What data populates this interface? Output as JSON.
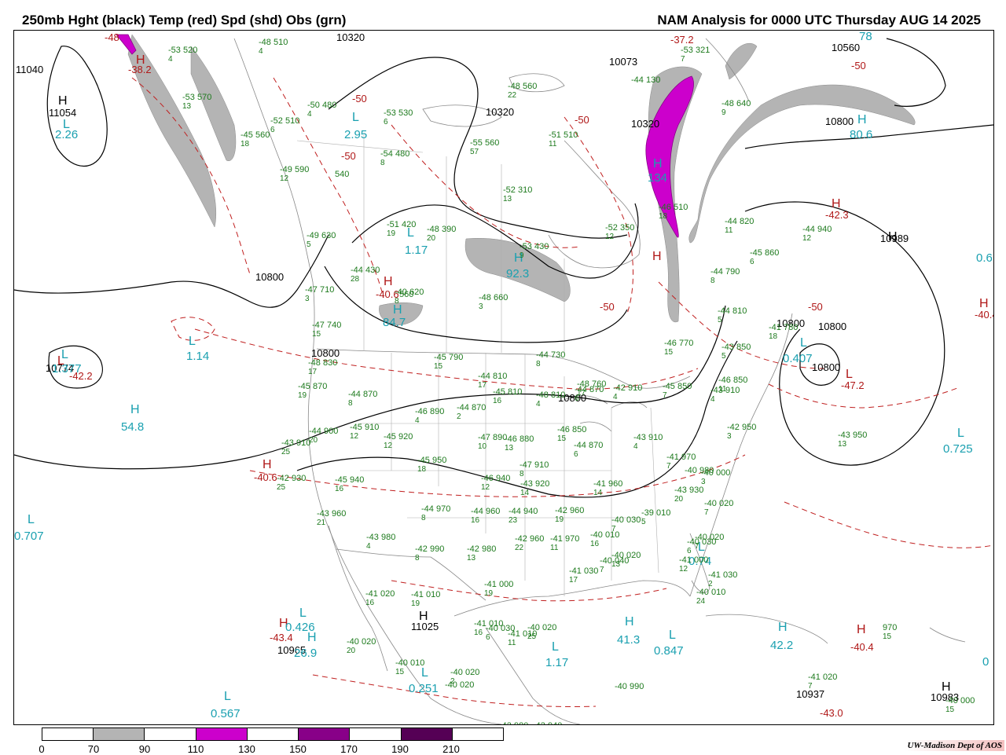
{
  "header": {
    "title_left": "250mb Hght (black) Temp (red) Spd (shd) Obs (grn)",
    "title_right": "NAM Analysis for 0000 UTC Thursday  AUG 14 2025"
  },
  "colors": {
    "height_contour": "#000000",
    "temp_contour": "#c02020",
    "speed_70_90": "#b4b4b4",
    "speed_110_130": "#cc00cc",
    "speed_150_170": "#880088",
    "speed_190_210": "#550055",
    "obs": "#1d7a1d",
    "speed_label": "#1aa0b0",
    "geography": "#888888"
  },
  "colorbar": {
    "ticks": [
      "0",
      "70",
      "90",
      "110",
      "130",
      "150",
      "170",
      "190",
      "210"
    ],
    "segments": [
      "#ffffff",
      "#b4b4b4",
      "#ffffff",
      "#cc00cc",
      "#ffffff",
      "#880088",
      "#ffffff",
      "#550055",
      "#ffffff"
    ]
  },
  "credit": "UW-Madison  Dept of AOS",
  "height_centers": [
    {
      "t": "H",
      "kind": "hgt-hl"
    },
    {
      "t": "11054",
      "kind": "hgt-val"
    },
    {
      "t": "11040",
      "kind": "hgt-val"
    },
    {
      "t": "10560",
      "kind": "hgt-val"
    },
    {
      "t": "10073",
      "kind": "hgt-val"
    },
    {
      "t": "10320",
      "kind": "hgt-val"
    },
    {
      "t": "10320",
      "kind": "hgt-val"
    },
    {
      "t": "10800",
      "kind": "hgt-val"
    },
    {
      "t": "H",
      "kind": "hgt-hl"
    },
    {
      "t": "10989",
      "kind": "hgt-val"
    },
    {
      "t": "10800",
      "kind": "hgt-val"
    },
    {
      "t": "10800",
      "kind": "hgt-val"
    },
    {
      "t": "10800",
      "kind": "hgt-val"
    },
    {
      "t": "10800",
      "kind": "hgt-val"
    },
    {
      "t": "10800",
      "kind": "hgt-val"
    },
    {
      "t": "10800",
      "kind": "hgt-val"
    },
    {
      "t": "H",
      "kind": "hgt-hl"
    },
    {
      "t": "11025",
      "kind": "hgt-val"
    },
    {
      "t": "10965",
      "kind": "hgt-val"
    },
    {
      "t": "10937",
      "kind": "hgt-val"
    },
    {
      "t": "H",
      "kind": "hgt-hl"
    },
    {
      "t": "10983",
      "kind": "hgt-val"
    },
    {
      "t": "10320",
      "kind": "hgt-val"
    },
    {
      "t": "10774",
      "kind": "hgt-val"
    }
  ],
  "temp_labels": [
    {
      "t": "-48",
      "kind": "temp"
    },
    {
      "t": "H",
      "kind": "temp-hl"
    },
    {
      "t": "-38.2",
      "kind": "temp"
    },
    {
      "t": "-50",
      "kind": "temp"
    },
    {
      "t": "-50",
      "kind": "temp"
    },
    {
      "t": "-50",
      "kind": "temp"
    },
    {
      "t": "-37.2",
      "kind": "temp"
    },
    {
      "t": "-50",
      "kind": "temp"
    },
    {
      "t": "H",
      "kind": "temp-hl"
    },
    {
      "t": "-42.3",
      "kind": "temp"
    },
    {
      "t": "H",
      "kind": "temp-hl"
    },
    {
      "t": "-50",
      "kind": "temp"
    },
    {
      "t": "H",
      "kind": "temp-hl"
    },
    {
      "t": "-40.6",
      "kind": "temp"
    },
    {
      "t": "L",
      "kind": "temp-hl"
    },
    {
      "t": "-42.2",
      "kind": "temp"
    },
    {
      "t": "L",
      "kind": "temp-hl"
    },
    {
      "t": "-47.2",
      "kind": "temp"
    },
    {
      "t": "H",
      "kind": "temp-hl"
    },
    {
      "t": "-40.6",
      "kind": "temp"
    },
    {
      "t": "H",
      "kind": "temp-hl"
    },
    {
      "t": "-43.4",
      "kind": "temp"
    },
    {
      "t": "H",
      "kind": "temp-hl"
    },
    {
      "t": "-40.4",
      "kind": "temp"
    },
    {
      "t": "-43.0",
      "kind": "temp"
    },
    {
      "t": "-50",
      "kind": "temp"
    },
    {
      "t": "H",
      "kind": "temp-hl"
    },
    {
      "t": "-40.4",
      "kind": "temp"
    }
  ],
  "speed_labels": [
    {
      "t": "L",
      "kind": "spd"
    },
    {
      "t": "2.26",
      "kind": "spd-val"
    },
    {
      "t": "L",
      "kind": "spd"
    },
    {
      "t": "2.95",
      "kind": "spd-val"
    },
    {
      "t": "L",
      "kind": "spd"
    },
    {
      "t": "1.17",
      "kind": "spd-val"
    },
    {
      "t": "H",
      "kind": "spd"
    },
    {
      "t": "92.3",
      "kind": "spd-val"
    },
    {
      "t": "H",
      "kind": "spd"
    },
    {
      "t": "84.7",
      "kind": "spd-val"
    },
    {
      "t": "H",
      "kind": "spd"
    },
    {
      "t": "80.6",
      "kind": "spd-val"
    },
    {
      "t": "H",
      "kind": "spd"
    },
    {
      "t": "134",
      "kind": "spd-val"
    },
    {
      "t": "78",
      "kind": "spd-val"
    },
    {
      "t": "L",
      "kind": "spd"
    },
    {
      "t": "1.14",
      "kind": "spd-val"
    },
    {
      "t": "L",
      "kind": "spd"
    },
    {
      "t": "1.377",
      "kind": "spd-val"
    },
    {
      "t": "H",
      "kind": "spd"
    },
    {
      "t": "54.8",
      "kind": "spd-val"
    },
    {
      "t": "L",
      "kind": "spd"
    },
    {
      "t": "0.707",
      "kind": "spd-val"
    },
    {
      "t": "L",
      "kind": "spd"
    },
    {
      "t": "0.407",
      "kind": "spd-val"
    },
    {
      "t": "L",
      "kind": "spd"
    },
    {
      "t": "0.725",
      "kind": "spd-val"
    },
    {
      "t": "L",
      "kind": "spd"
    },
    {
      "t": "0.426",
      "kind": "spd-val"
    },
    {
      "t": "H",
      "kind": "spd"
    },
    {
      "t": "26.9",
      "kind": "spd-val"
    },
    {
      "t": "L",
      "kind": "spd"
    },
    {
      "t": "0.567",
      "kind": "spd-val"
    },
    {
      "t": "L",
      "kind": "spd"
    },
    {
      "t": "0.251",
      "kind": "spd-val"
    },
    {
      "t": "L",
      "kind": "spd"
    },
    {
      "t": "1.17",
      "kind": "spd-val"
    },
    {
      "t": "H",
      "kind": "spd"
    },
    {
      "t": "41.3",
      "kind": "spd-val"
    },
    {
      "t": "L",
      "kind": "spd"
    },
    {
      "t": "0.847",
      "kind": "spd-val"
    },
    {
      "t": "H",
      "kind": "spd"
    },
    {
      "t": "42.2",
      "kind": "spd-val"
    },
    {
      "t": "L",
      "kind": "spd"
    },
    {
      "t": "0.74",
      "kind": "spd-val"
    },
    {
      "t": "0.6",
      "kind": "spd-val"
    },
    {
      "t": "0",
      "kind": "spd-val"
    }
  ],
  "obs": [
    {
      "t": "-53",
      "h": "520",
      "d": "4"
    },
    {
      "t": "-48",
      "h": "510",
      "d": "4"
    },
    {
      "t": "-53",
      "h": "570",
      "d": "13"
    },
    {
      "t": "-50",
      "h": "480",
      "d": "4"
    },
    {
      "t": "-52",
      "h": "510",
      "d": "6"
    },
    {
      "t": "-53",
      "h": "530",
      "d": "6"
    },
    {
      "t": "-45",
      "h": "560",
      "d": "18"
    },
    {
      "t": "-54",
      "h": "480",
      "d": "8"
    },
    {
      "t": "-49",
      "h": "590",
      "d": "12"
    },
    {
      "t": "540",
      "h": "",
      "d": ""
    },
    {
      "t": "-48",
      "h": "560",
      "d": "22"
    },
    {
      "t": "-55",
      "h": "560",
      "d": "57"
    },
    {
      "t": "-51",
      "h": "510",
      "d": "11"
    },
    {
      "t": "-52",
      "h": "310",
      "d": "13"
    },
    {
      "t": "-44",
      "h": "130",
      "d": ""
    },
    {
      "t": "-48",
      "h": "640",
      "d": "9"
    },
    {
      "t": "-53",
      "h": "321",
      "d": "7"
    },
    {
      "t": "-51",
      "h": "420",
      "d": "19"
    },
    {
      "t": "-48",
      "h": "390",
      "d": "20"
    },
    {
      "t": "-52",
      "h": "350",
      "d": "12"
    },
    {
      "t": "-49",
      "h": "630",
      "d": "5"
    },
    {
      "t": "-44",
      "h": "430",
      "d": "28"
    },
    {
      "t": "-53",
      "h": "430",
      "d": "9"
    },
    {
      "t": "-47",
      "h": "710",
      "d": "3"
    },
    {
      "t": "-40",
      "h": "620",
      "d": "8"
    },
    {
      "t": "560",
      "h": "",
      "d": ""
    },
    {
      "t": "-46",
      "h": "510",
      "d": "18"
    },
    {
      "t": "-44",
      "h": "820",
      "d": "11"
    },
    {
      "t": "-44",
      "h": "940",
      "d": "12"
    },
    {
      "t": "-45",
      "h": "860",
      "d": "6"
    },
    {
      "t": "-44",
      "h": "790",
      "d": "8"
    },
    {
      "t": "-48",
      "h": "660",
      "d": "3"
    },
    {
      "t": "-47",
      "h": "740",
      "d": "15"
    },
    {
      "t": "-44",
      "h": "730",
      "d": "8"
    },
    {
      "t": "-46",
      "h": "770",
      "d": "15"
    },
    {
      "t": "-44",
      "h": "810",
      "d": "5"
    },
    {
      "t": "-41",
      "h": "780",
      "d": "18"
    },
    {
      "t": "-43",
      "h": "850",
      "d": "5"
    },
    {
      "t": "-48",
      "h": "830",
      "d": "17"
    },
    {
      "t": "-45",
      "h": "790",
      "d": "15"
    },
    {
      "t": "-44",
      "h": "810",
      "d": "17"
    },
    {
      "t": "-45",
      "h": "870",
      "d": "19"
    },
    {
      "t": "-44",
      "h": "870",
      "d": "8"
    },
    {
      "t": "-45",
      "h": "810",
      "d": "16"
    },
    {
      "t": "-48",
      "h": "810",
      "d": "4"
    },
    {
      "t": "-48",
      "h": "760",
      "d": "17"
    },
    {
      "t": "-44",
      "h": "870",
      "d": "6"
    },
    {
      "t": "-42",
      "h": "910",
      "d": "4"
    },
    {
      "t": "-45",
      "h": "850",
      "d": "7"
    },
    {
      "t": "-46",
      "h": "850",
      "d": "11"
    },
    {
      "t": "-43",
      "h": "910",
      "d": "4"
    },
    {
      "t": "-42",
      "h": "950",
      "d": "3"
    },
    {
      "t": "-46",
      "h": "890",
      "d": "4"
    },
    {
      "t": "-44",
      "h": "870",
      "d": "2"
    },
    {
      "t": "-44",
      "h": "900",
      "d": "20"
    },
    {
      "t": "-45",
      "h": "910",
      "d": "12"
    },
    {
      "t": "-45",
      "h": "920",
      "d": "12"
    },
    {
      "t": "-47",
      "h": "890",
      "d": "10"
    },
    {
      "t": "-46",
      "h": "880",
      "d": "13"
    },
    {
      "t": "-46",
      "h": "850",
      "d": "15"
    },
    {
      "t": "-44",
      "h": "870",
      "d": "6"
    },
    {
      "t": "-43",
      "h": "910",
      "d": "4"
    },
    {
      "t": "-43",
      "h": "950",
      "d": "13"
    },
    {
      "t": "-43",
      "h": "910",
      "d": "25"
    },
    {
      "t": "-45",
      "h": "950",
      "d": "18"
    },
    {
      "t": "-47",
      "h": "910",
      "d": "8"
    },
    {
      "t": "-41",
      "h": "970",
      "d": "7"
    },
    {
      "t": "-40",
      "h": "980",
      "d": ""
    },
    {
      "t": "-40",
      "h": "000",
      "d": "3"
    },
    {
      "t": "-42",
      "h": "930",
      "d": "25"
    },
    {
      "t": "-45",
      "h": "940",
      "d": "16"
    },
    {
      "t": "-46",
      "h": "940",
      "d": "12"
    },
    {
      "t": "-43",
      "h": "920",
      "d": "14"
    },
    {
      "t": "-41",
      "h": "960",
      "d": "14"
    },
    {
      "t": "-43",
      "h": "930",
      "d": "20"
    },
    {
      "t": "-40",
      "h": "020",
      "d": "7"
    },
    {
      "t": "-43",
      "h": "960",
      "d": "21"
    },
    {
      "t": "-44",
      "h": "970",
      "d": "8"
    },
    {
      "t": "-44",
      "h": "960",
      "d": "16"
    },
    {
      "t": "-44",
      "h": "940",
      "d": "23"
    },
    {
      "t": "-42",
      "h": "960",
      "d": "19"
    },
    {
      "t": "-40",
      "h": "030",
      "d": "7"
    },
    {
      "t": "-39",
      "h": "010",
      "d": "5"
    },
    {
      "t": "-43",
      "h": "980",
      "d": "4"
    },
    {
      "t": "-42",
      "h": "990",
      "d": "8"
    },
    {
      "t": "-42",
      "h": "980",
      "d": "13"
    },
    {
      "t": "-42",
      "h": "960",
      "d": "22"
    },
    {
      "t": "-41",
      "h": "970",
      "d": "11"
    },
    {
      "t": "-40",
      "h": "010",
      "d": "16"
    },
    {
      "t": "-40",
      "h": "020",
      "d": "13"
    },
    {
      "t": "-40",
      "h": "040",
      "d": "7"
    },
    {
      "t": "-40",
      "h": "030",
      "d": "6"
    },
    {
      "t": "-41",
      "h": "000",
      "d": "12"
    },
    {
      "t": "-41",
      "h": "030",
      "d": "17"
    },
    {
      "t": "-41",
      "h": "030",
      "d": "2"
    },
    {
      "t": "-40",
      "h": "010",
      "d": "24"
    },
    {
      "t": "-41",
      "h": "020",
      "d": "16"
    },
    {
      "t": "-41",
      "h": "010",
      "d": "19"
    },
    {
      "t": "-41",
      "h": "000",
      "d": "19"
    },
    {
      "t": "-41",
      "h": "010",
      "d": "16"
    },
    {
      "t": "-41",
      "h": "010",
      "d": "11"
    },
    {
      "t": "-40",
      "h": "020",
      "d": "25"
    },
    {
      "t": "-40",
      "h": "030",
      "d": "6"
    },
    {
      "t": "-40",
      "h": "020",
      "d": "20"
    },
    {
      "t": "-40",
      "h": "010",
      "d": "15"
    },
    {
      "t": "-40",
      "h": "020",
      "d": "2"
    },
    {
      "t": "-40",
      "h": "020",
      "d": ""
    },
    {
      "t": "-40",
      "h": "990",
      "d": ""
    },
    {
      "t": "-42",
      "h": "980",
      "d": "21"
    },
    {
      "t": "-42",
      "h": "940",
      "d": "14"
    },
    {
      "t": "970",
      "h": "",
      "d": "15"
    },
    {
      "t": "-41",
      "h": "020",
      "d": "7"
    },
    {
      "t": "-40",
      "h": "000",
      "d": "15"
    },
    {
      "t": "-40",
      "h": "020",
      "d": "7"
    }
  ]
}
